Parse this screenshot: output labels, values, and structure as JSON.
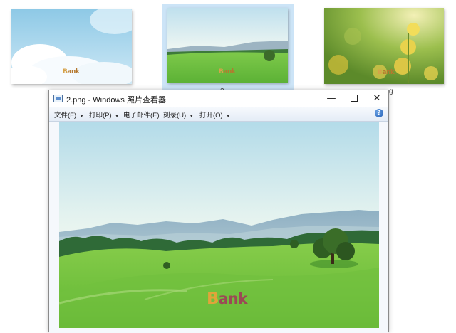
{
  "window": {
    "title": "2.png - Windows 照片查看器",
    "minimize_glyph": "—",
    "close_glyph": "✕"
  },
  "menu": [
    {
      "label": "文件(F)"
    },
    {
      "label": "打印(P)"
    },
    {
      "label": "电子邮件(E)"
    },
    {
      "label": "刻录(U)"
    },
    {
      "label": "打开(O)"
    }
  ],
  "help": {
    "glyph": "?"
  },
  "watermark": {
    "prefix": "B",
    "rest": "ank"
  },
  "explorer": {
    "label_fragment_2": "2",
    "label_fragment_3": "g"
  },
  "icons": [
    "photo-viewer-app-icon",
    "minimize-icon",
    "maximize-icon",
    "close-icon",
    "help-icon",
    "chevron-down-icon"
  ]
}
